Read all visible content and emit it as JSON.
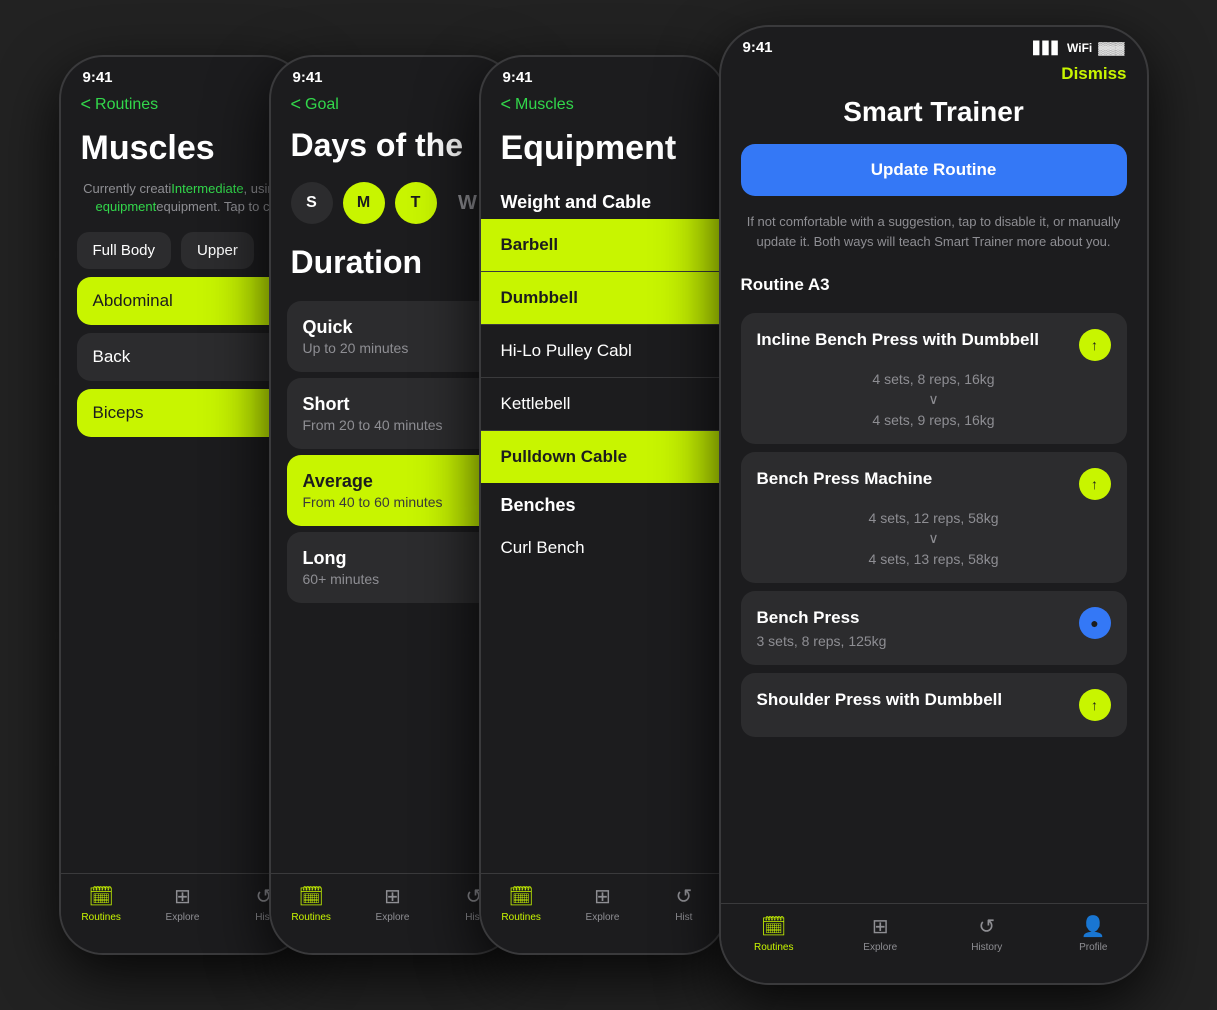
{
  "phone1": {
    "time": "9:41",
    "back_label": "Routines",
    "page_title": "Muscles",
    "subtitle_plain": "Currently creati",
    "subtitle_highlight": "Intermediate",
    "subtitle_cont": ", using",
    "subtitle_end": "equipment. Tap to c",
    "chips": [
      "Full Body",
      "Upper"
    ],
    "muscles": [
      {
        "label": "Abdominal",
        "active": true
      },
      {
        "label": "Back",
        "active": false
      },
      {
        "label": "Biceps",
        "active": true
      }
    ],
    "tabs": [
      {
        "icon": "🗓",
        "label": "Routines",
        "active": true
      },
      {
        "icon": "⊞",
        "label": "Explore",
        "active": false
      },
      {
        "icon": "↺",
        "label": "Hist",
        "active": false
      }
    ]
  },
  "phone2": {
    "time": "9:41",
    "back_label": "Goal",
    "days": [
      {
        "label": "S",
        "active": false
      },
      {
        "label": "M",
        "active": true
      },
      {
        "label": "T",
        "active": true
      },
      {
        "label": "W",
        "active": false
      }
    ],
    "duration_title": "Duration",
    "durations": [
      {
        "title": "Quick",
        "sub": "Up to 20 minutes",
        "active": false
      },
      {
        "title": "Short",
        "sub": "From 20 to 40 minutes",
        "active": false
      },
      {
        "title": "Average",
        "sub": "From 40 to 60 minutes",
        "active": true
      },
      {
        "title": "Long",
        "sub": "60+ minutes",
        "active": false
      }
    ],
    "tabs": [
      {
        "icon": "🗓",
        "label": "Routines",
        "active": true
      },
      {
        "icon": "⊞",
        "label": "Explore",
        "active": false
      },
      {
        "icon": "↺",
        "label": "Hist",
        "active": false
      }
    ]
  },
  "phone3": {
    "time": "9:41",
    "back_label": "Muscles",
    "page_title": "Equipment",
    "section1": "Weight and Cable",
    "equipment1": [
      {
        "label": "Barbell",
        "active": true
      },
      {
        "label": "Dumbbell",
        "active": true
      },
      {
        "label": "Hi-Lo Pulley Cabl",
        "active": false
      },
      {
        "label": "Kettlebell",
        "active": false
      },
      {
        "label": "Pulldown Cable",
        "active": true
      }
    ],
    "section2": "Benches",
    "equipment2": [
      {
        "label": "Curl Bench",
        "active": false
      }
    ],
    "tabs": [
      {
        "icon": "🗓",
        "label": "Routines",
        "active": true
      },
      {
        "icon": "⊞",
        "label": "Explore",
        "active": false
      },
      {
        "icon": "↺",
        "label": "Hist",
        "active": false
      }
    ]
  },
  "phone4": {
    "time": "9:41",
    "dismiss_label": "Dismiss",
    "title": "Smart Trainer",
    "update_btn": "Update Routine",
    "description": "If not comfortable with a suggestion, tap to disable it, or manually update it. Both ways will teach Smart Trainer more about you.",
    "routine_label": "Routine A3",
    "exercises": [
      {
        "name": "Incline Bench Press with Dumbbell",
        "sets_old": "4 sets, 8 reps, 16kg",
        "sets_new": "4 sets, 9 reps, 16kg",
        "icon": "↑",
        "icon_type": "green"
      },
      {
        "name": "Bench Press Machine",
        "sets_old": "4 sets, 12 reps, 58kg",
        "sets_new": "4 sets, 13 reps, 58kg",
        "icon": "↑",
        "icon_type": "green"
      },
      {
        "name": "Bench Press",
        "sets_only": "3 sets, 8 reps, 125kg",
        "icon": "●",
        "icon_type": "blue"
      },
      {
        "name": "Shoulder Press with Dumbbell",
        "icon": "↑",
        "icon_type": "green"
      }
    ]
  }
}
